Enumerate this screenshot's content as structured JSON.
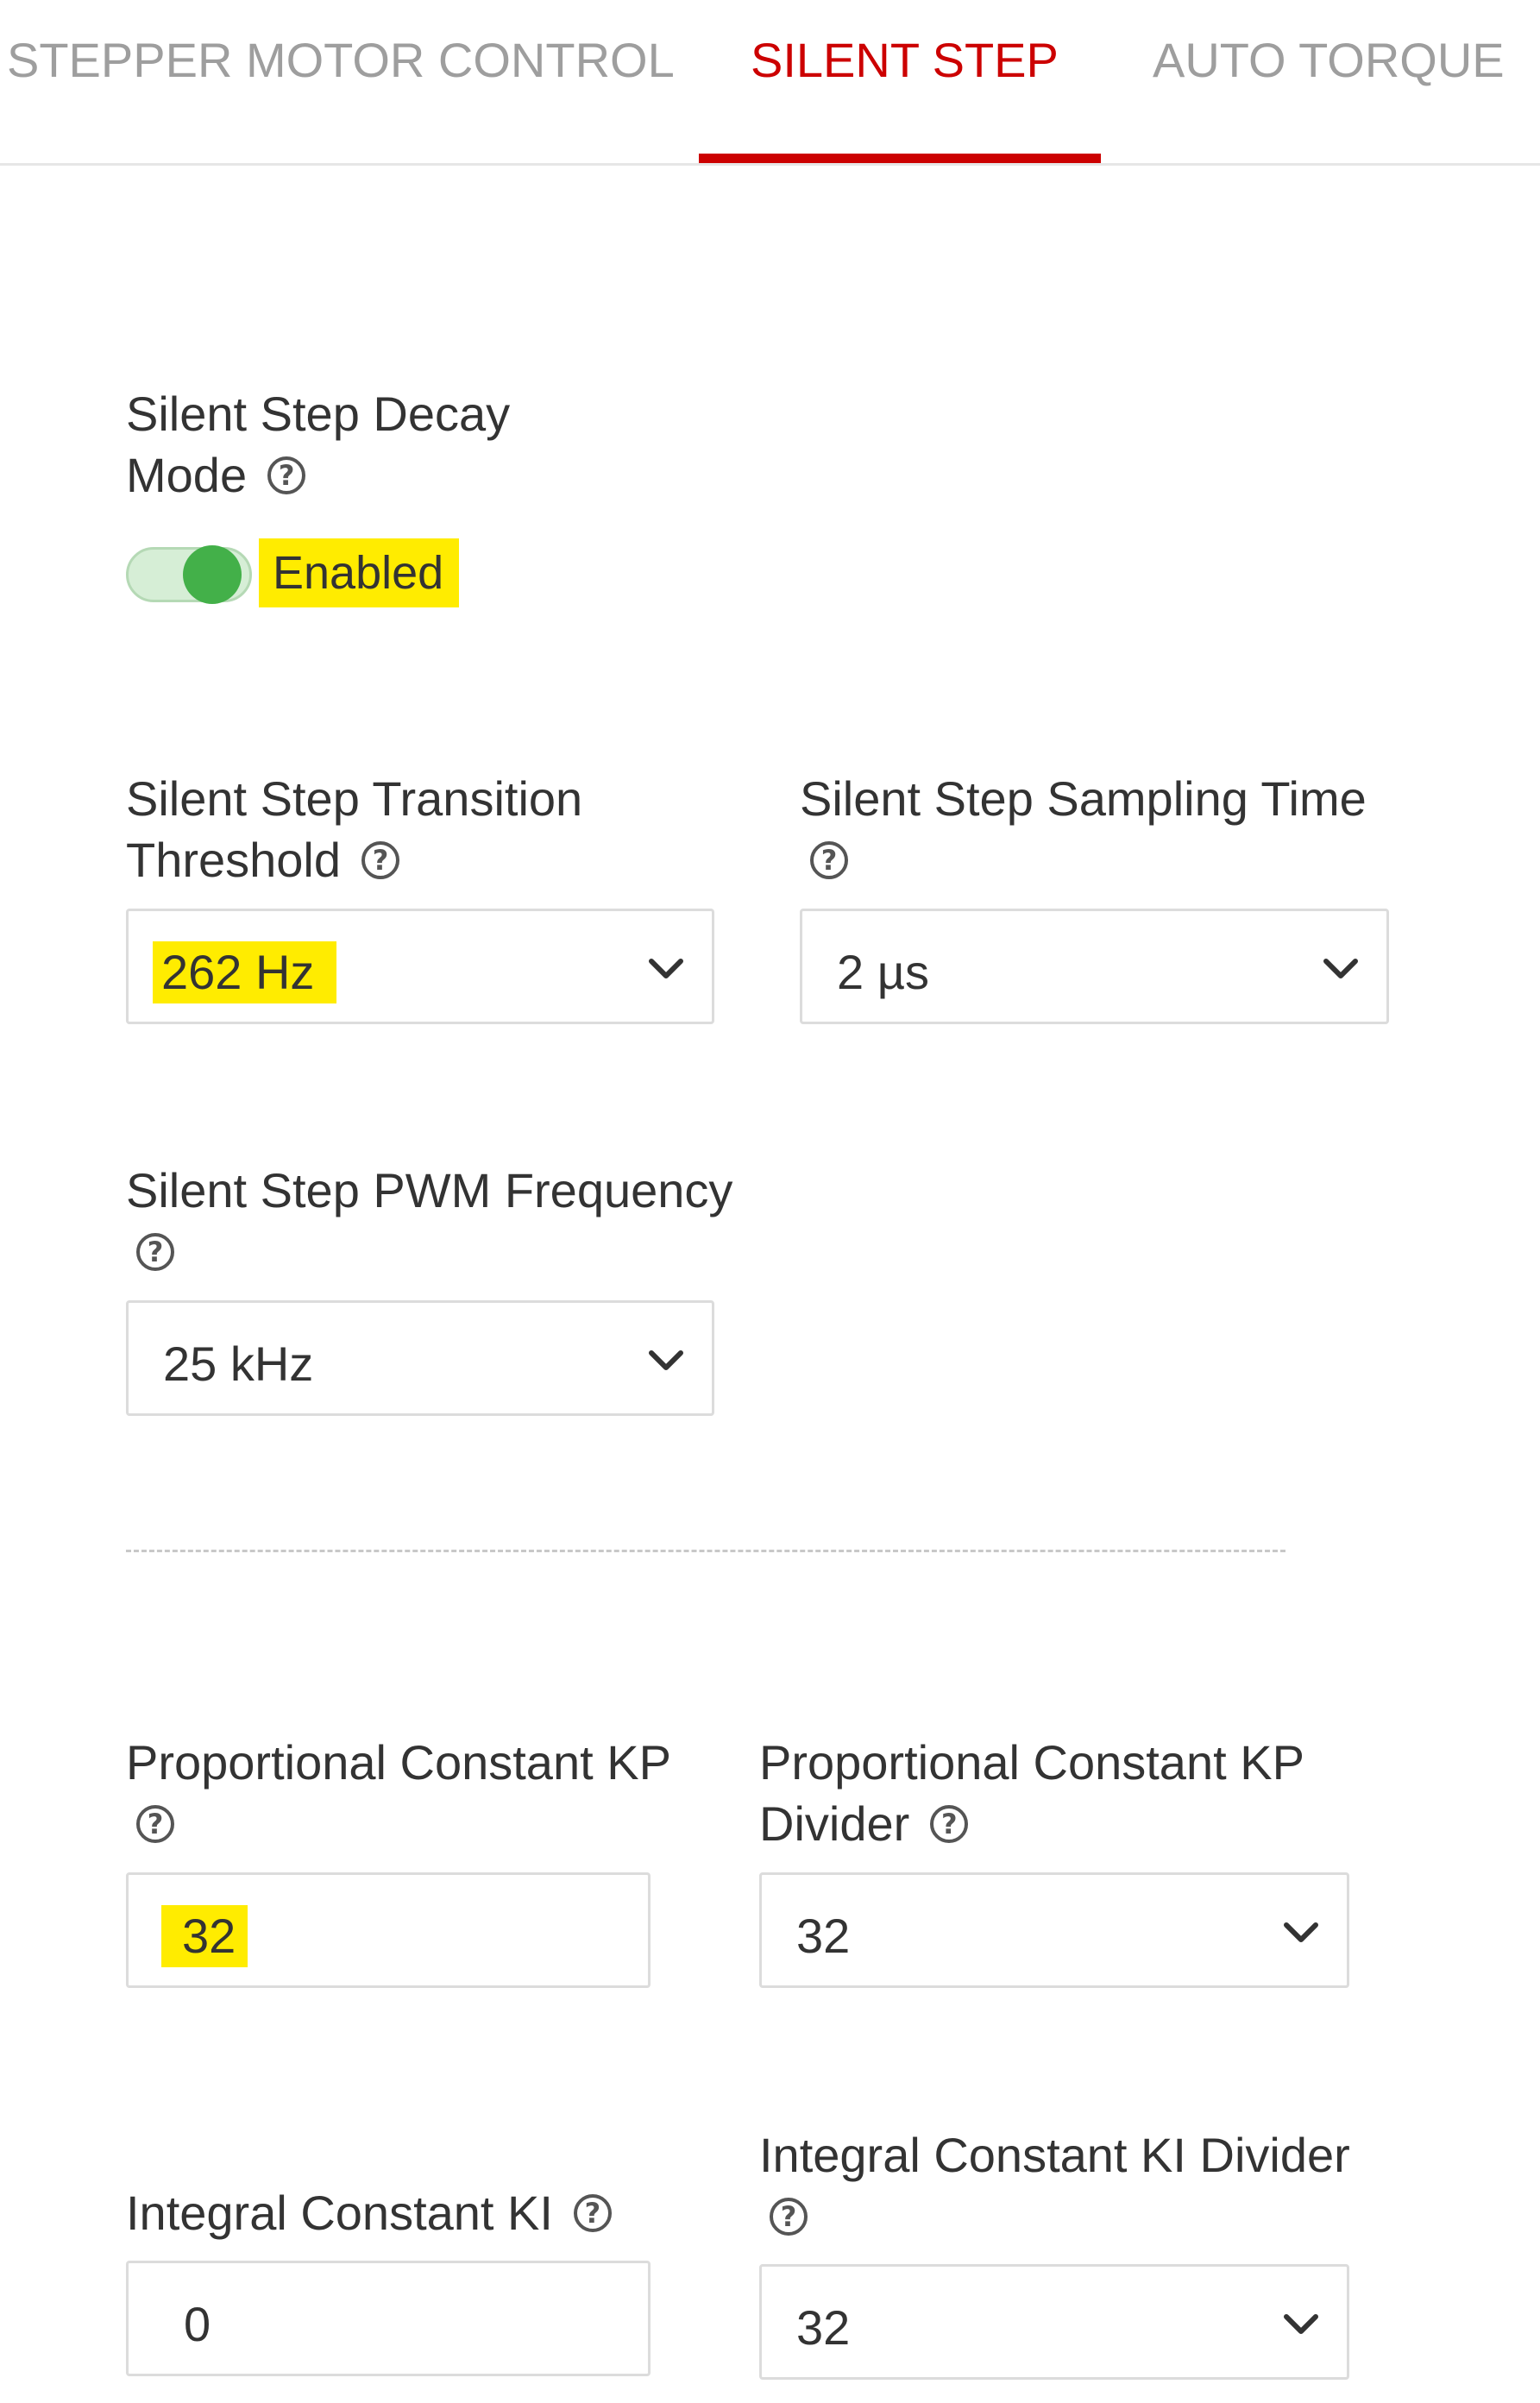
{
  "tabs": [
    {
      "label": "STEPPER MOTOR CONTROL",
      "active": false
    },
    {
      "label": "SILENT STEP",
      "active": true
    },
    {
      "label": "AUTO TORQUE",
      "active": false
    }
  ],
  "decay_mode": {
    "label_line1": "Silent Step Decay",
    "label_line2": "Mode",
    "state_text": "Enabled",
    "enabled": true
  },
  "transition_threshold": {
    "label_line1": "Silent Step Transition",
    "label_line2": "Threshold",
    "value": "262 Hz"
  },
  "sampling_time": {
    "label": "Silent Step Sampling Time",
    "value": "2 µs"
  },
  "pwm_frequency": {
    "label": "Silent Step PWM Frequency",
    "value": "25 kHz"
  },
  "kp": {
    "label": "Proportional Constant KP",
    "value": "32"
  },
  "kp_divider": {
    "label_line1": "Proportional Constant KP",
    "label_line2": "Divider",
    "value": "32"
  },
  "ki": {
    "label": "Integral Constant KI",
    "value": "0"
  },
  "ki_divider": {
    "label": "Integral Constant KI Divider",
    "value": "32"
  },
  "help_glyph": "?",
  "colors": {
    "accent": "#cc0000",
    "toggle_on": "#43b049",
    "highlight": "#ffec00",
    "tab_inactive": "#9e9e9e"
  }
}
